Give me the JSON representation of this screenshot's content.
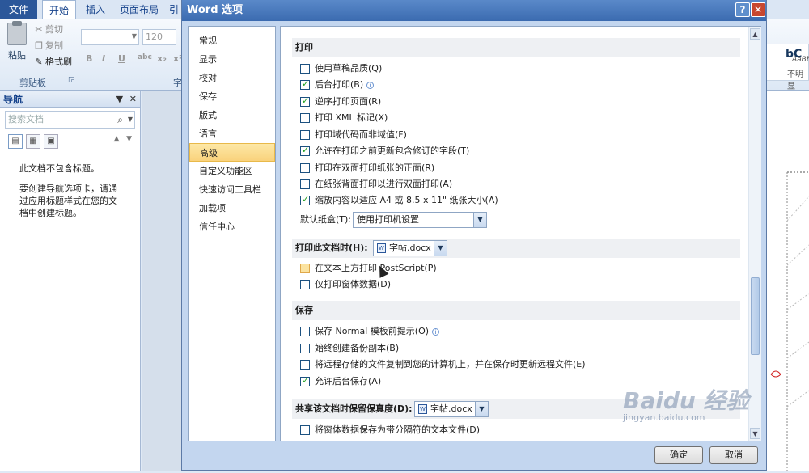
{
  "ribbon": {
    "tabs": [
      "文件",
      "开始",
      "插入",
      "页面布局",
      "引"
    ],
    "clipboard": {
      "paste": "粘贴",
      "cut": "剪切",
      "copy": "复制",
      "format_painter": "格式刷",
      "group": "剪贴板"
    },
    "font": {
      "size": "120",
      "group_partial": "字",
      "format_buttons": [
        "B",
        "I",
        "U",
        "abc",
        "x₂",
        "x²"
      ]
    },
    "styles": {
      "sample1": "bC",
      "sample2": "AaBb",
      "sample3": "不明显"
    }
  },
  "nav_pane": {
    "title": "导航",
    "search_placeholder": "搜索文档",
    "no_headings": "此文档不包含标题。",
    "help_text": "要创建导航选项卡，请通过应用标题样式在您的文档中创建标题。"
  },
  "dialog": {
    "title": "Word 选项",
    "categories": [
      "常规",
      "显示",
      "校对",
      "保存",
      "版式",
      "语言",
      "高级",
      "自定义功能区",
      "快速访问工具栏",
      "加载项",
      "信任中心"
    ],
    "selected_category": "高级",
    "print_section": {
      "title": "打印",
      "options": [
        {
          "label": "使用草稿品质(Q)",
          "checked": false
        },
        {
          "label": "后台打印(B)",
          "checked": true,
          "info": true
        },
        {
          "label": "逆序打印页面(R)",
          "checked": true
        },
        {
          "label": "打印 XML 标记(X)",
          "checked": false
        },
        {
          "label": "打印域代码而非域值(F)",
          "checked": false
        },
        {
          "label": "允许在打印之前更新包含修订的字段(T)",
          "checked": true
        },
        {
          "label": "打印在双面打印纸张的正面(R)",
          "checked": false
        },
        {
          "label": "在纸张背面打印以进行双面打印(A)",
          "checked": false
        },
        {
          "label": "缩放内容以适应 A4 或 8.5 x 11\" 纸张大小(A)",
          "checked": true
        }
      ],
      "tray_label": "默认纸盒(T):",
      "tray_value": "使用打印机设置"
    },
    "print_doc_section": {
      "title": "打印此文档时(H):",
      "doc": "字帖.docx",
      "options": [
        {
          "label": "在文本上方打印 PostScript(P)",
          "checked": false,
          "hover": true
        },
        {
          "label": "仅打印窗体数据(D)",
          "checked": false
        }
      ]
    },
    "save_section": {
      "title": "保存",
      "options": [
        {
          "label": "保存 Normal 模板前提示(O)",
          "checked": false,
          "info": true
        },
        {
          "label": "始终创建备份副本(B)",
          "checked": false
        },
        {
          "label": "将远程存储的文件复制到您的计算机上，并在保存时更新远程文件(E)",
          "checked": false
        },
        {
          "label": "允许后台保存(A)",
          "checked": true
        }
      ]
    },
    "share_section": {
      "title": "共享该文档时保留保真度(D):",
      "doc": "字帖.docx",
      "options": [
        {
          "label": "将窗体数据保存为带分隔符的文本文件(D)",
          "checked": false
        }
      ]
    },
    "ok": "确定",
    "cancel": "取消"
  },
  "watermark": {
    "brand": "Baidu 经验",
    "url": "jingyan.baidu.com"
  }
}
